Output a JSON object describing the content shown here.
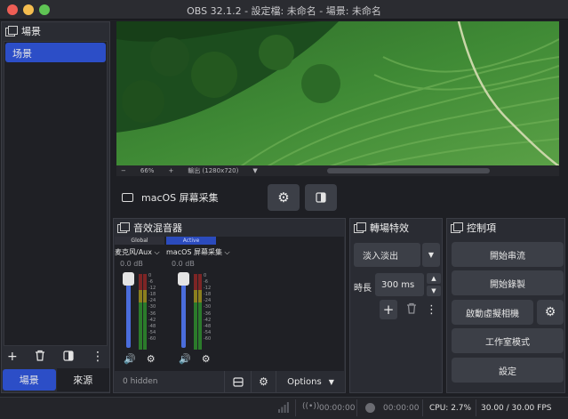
{
  "window": {
    "title": "OBS 32.1.2 - 設定檔: 未命名 - 場景: 未命名"
  },
  "scenes": {
    "title": "場景",
    "items": [
      "场景"
    ],
    "tab_scenes": "場景",
    "tab_sources": "來源"
  },
  "preview": {
    "zoom": "66%",
    "minus": "−",
    "plus": "+",
    "resolution": "輸出 (1280x720)"
  },
  "source_bar": {
    "source_name": "macOS 屏幕采集"
  },
  "mixer": {
    "title": "音效混音器",
    "channels": [
      {
        "header": "Global",
        "name": "麦克风/Aux",
        "db": "0.0 dB"
      },
      {
        "header": "Active",
        "name": "macOS 屏幕采集",
        "db": "0.0 dB"
      }
    ],
    "ticks": [
      "0",
      "-6",
      "-12",
      "-18",
      "-24",
      "-30",
      "-36",
      "-42",
      "-48",
      "-54",
      "-60"
    ],
    "hidden": "0 hidden",
    "options": "Options"
  },
  "transitions": {
    "title": "轉場特效",
    "selected": "淡入淡出",
    "duration_label": "時長",
    "duration_value": "300 ms"
  },
  "controls": {
    "title": "控制項",
    "start_stream": "開始串流",
    "start_record": "開始錄製",
    "start_vcam": "啟動虛擬相機",
    "studio_mode": "工作室模式",
    "settings": "設定"
  },
  "status": {
    "stream_time": "00:00:00",
    "record_time": "00:00:00",
    "cpu": "CPU: 2.7%",
    "fps": "30.00 / 30.00 FPS"
  },
  "colors": {
    "accent": "#2c4ec7",
    "panel": "#2a2c33",
    "button": "#3c3f47"
  }
}
